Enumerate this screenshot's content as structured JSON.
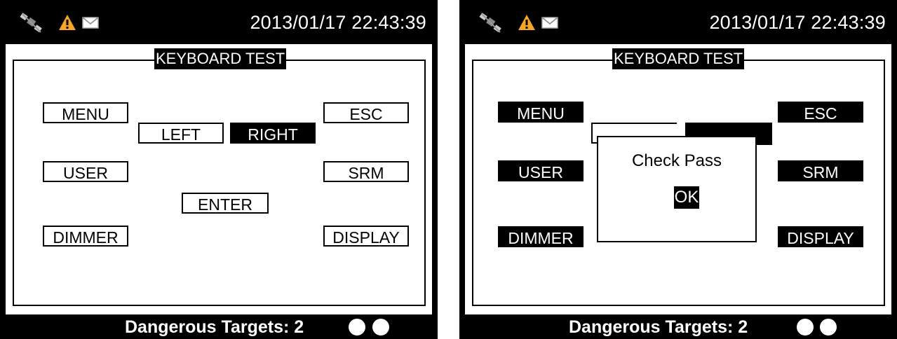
{
  "screens": [
    {
      "datetime": "2013/01/17 22:43:39",
      "title": "KEYBOARD TEST",
      "keys": {
        "menu": "MENU",
        "esc": "ESC",
        "left": "LEFT",
        "right": "RIGHT",
        "user": "USER",
        "srm": "SRM",
        "enter": "ENTER",
        "dimmer": "DIMMER",
        "display": "DISPLAY"
      },
      "status": "Dangerous Targets:  2"
    },
    {
      "datetime": "2013/01/17 22:43:39",
      "title": "KEYBOARD TEST",
      "keys": {
        "menu": "MENU",
        "esc": "ESC",
        "user": "USER",
        "srm": "SRM",
        "dimmer": "DIMMER",
        "display": "DISPLAY"
      },
      "dialog": {
        "message": "Check Pass",
        "ok": "OK"
      },
      "status": "Dangerous Targets:  2"
    }
  ],
  "icons": [
    "satellite-icon",
    "warning-icon",
    "mail-icon"
  ],
  "colors": {
    "background": "#000000",
    "panel": "#ffffff",
    "warning": "#f5a623"
  }
}
